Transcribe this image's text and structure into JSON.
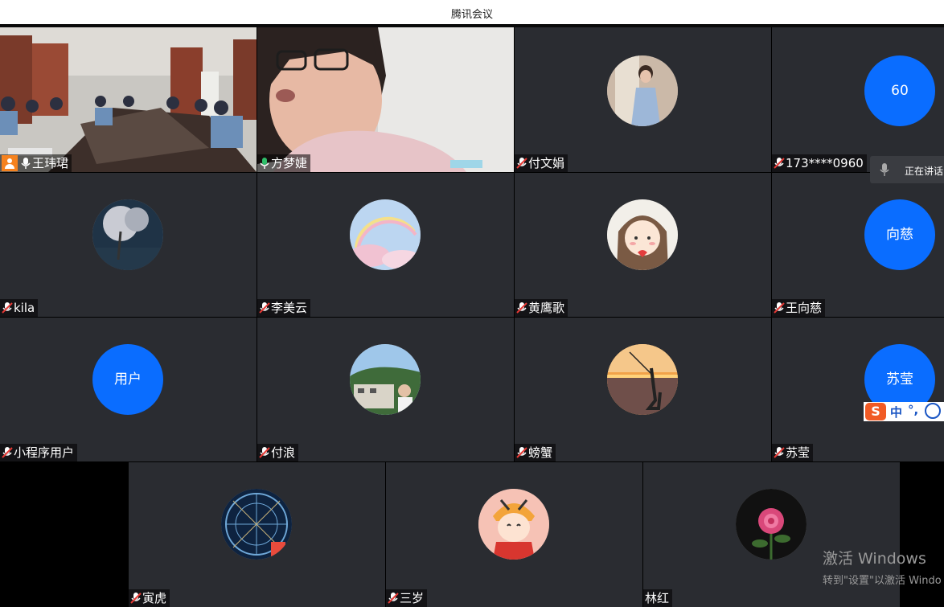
{
  "window": {
    "title": "腾讯会议"
  },
  "participants": [
    {
      "name": "王玮珺",
      "host": true,
      "mic": "on"
    },
    {
      "name": "方梦婕",
      "mic": "on"
    },
    {
      "name": "付文娟",
      "mic": "muted",
      "avatar": "photo"
    },
    {
      "name": "173****0960",
      "mic": "muted",
      "avatar_text": "60"
    },
    {
      "name": "kila",
      "mic": "muted",
      "avatar": "photo"
    },
    {
      "name": "李美云",
      "mic": "muted",
      "avatar": "photo"
    },
    {
      "name": "黄鹰歌",
      "mic": "muted",
      "avatar": "photo"
    },
    {
      "name": "王向慈",
      "mic": "muted",
      "avatar_text": "向慈"
    },
    {
      "name": "小程序用户",
      "mic": "muted",
      "avatar_text": "用户"
    },
    {
      "name": "付浪",
      "mic": "muted",
      "avatar": "photo"
    },
    {
      "name": "螃蟹",
      "mic": "muted",
      "avatar": "photo"
    },
    {
      "name": "苏莹",
      "mic": "muted",
      "avatar_text": "苏莹"
    },
    {
      "name": "寅虎",
      "mic": "muted",
      "avatar": "photo"
    },
    {
      "name": "三岁",
      "mic": "muted",
      "avatar": "photo"
    },
    {
      "name": "林红",
      "mic": "none",
      "avatar": "photo"
    }
  ],
  "speaking_panel": {
    "label": "正在讲话"
  },
  "ime_toolbar": {
    "logo": "S",
    "mode": "中",
    "punct": "°,",
    "emoji": "☺"
  },
  "os_watermark": {
    "line1": "激活 Windows",
    "line2": "转到\"设置\"以激活 Windo"
  },
  "colors": {
    "accent": "#0a6dff",
    "tile_bg": "#2a2c31",
    "host_badge": "#f5821f",
    "mic_active": "#2fbf6a"
  }
}
